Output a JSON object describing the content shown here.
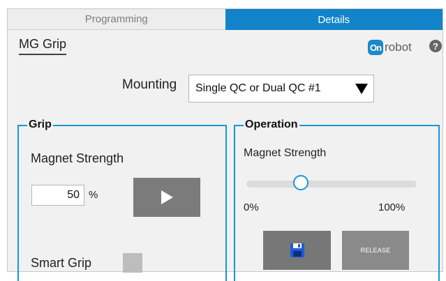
{
  "tabs": [
    {
      "label": "Programming",
      "active": false
    },
    {
      "label": "Details",
      "active": true
    }
  ],
  "page_title": "MG Grip",
  "logo": {
    "badge": "On",
    "text": "robot"
  },
  "help_icon": "?",
  "mounting": {
    "label": "Mounting",
    "value": "Single QC or Dual QC #1"
  },
  "grip": {
    "legend": "Grip",
    "magnet_strength_label": "Magnet Strength",
    "value": "50",
    "unit": "%",
    "smart_grip_label": "Smart Grip"
  },
  "operation": {
    "legend": "Operation",
    "magnet_strength_label": "Magnet Strength",
    "slider_value_fraction": 0.3,
    "min_label": "0%",
    "max_label": "100%",
    "release_label": "RELEASE"
  },
  "colors": {
    "accent": "#1283c9",
    "group_border": "#1896d8"
  }
}
